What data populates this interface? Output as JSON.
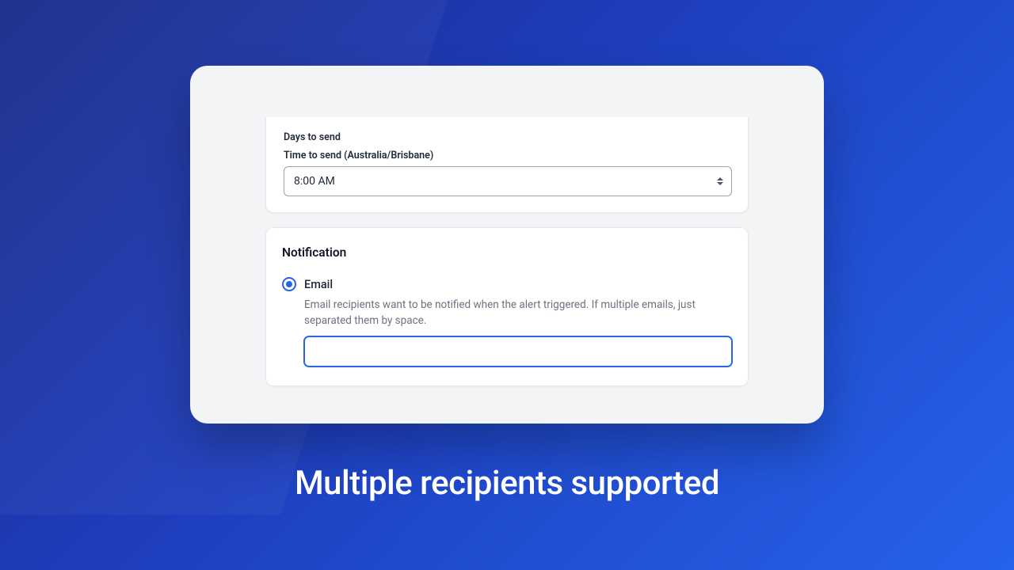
{
  "schedule": {
    "days_label": "Days to send",
    "time_label": "Time to send (Australia/Brisbane)",
    "time_value": "8:00 AM"
  },
  "notification": {
    "title": "Notification",
    "option_label": "Email",
    "help_text": "Email recipients want to be notified when the alert triggered. If multiple emails, just separated them by space.",
    "input_value": ""
  },
  "caption": "Multiple recipients supported"
}
